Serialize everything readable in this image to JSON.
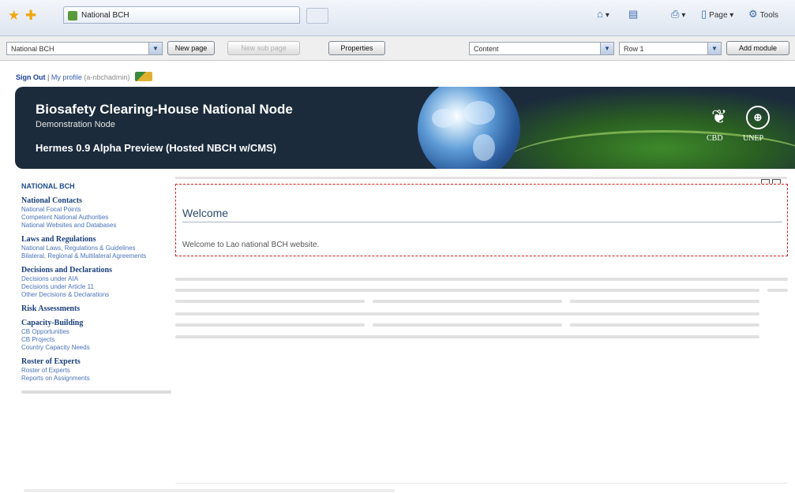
{
  "browser": {
    "tab_title": "National BCH",
    "commands": {
      "home_glyph": "⌂",
      "feeds_glyph": "▤",
      "print_glyph": "⎙",
      "page_label": "Page",
      "page_glyph": "▯",
      "tools_label": "Tools",
      "tools_glyph": "⚙"
    },
    "icons": {
      "favorites": "favorites-star-icon",
      "add_favorite": "add-favorite-icon",
      "star": "★",
      "add": "✚"
    }
  },
  "cms_toolbar": {
    "page_select": "National BCH",
    "new_page": "New page",
    "new_sub_page": "New sub page",
    "properties": "Properties",
    "pane_select": "Content",
    "row_select": "Row 1",
    "add_module": "Add module",
    "arrow": "▼"
  },
  "userbar": {
    "sign_out": "Sign Out",
    "separator": " | ",
    "my_profile": "My profile",
    "username": "(a-nbchadmin)"
  },
  "banner": {
    "title": "Biosafety Clearing-House National Node",
    "subtitle": "Demonstration Node",
    "headline": "Hermes 0.9 Alpha Preview (Hosted NBCH w/CMS)",
    "cbd_label": "CBD",
    "unep_label": "UNEP",
    "cbd_glyph": "❦",
    "unep_glyph": "⊕"
  },
  "nav": {
    "heading": "NATIONAL BCH",
    "sections": [
      {
        "title": "National Contacts",
        "links": [
          "National Focal Points",
          "Competent National Authorities",
          "National Websites and Databases"
        ]
      },
      {
        "title": "Laws and Regulations",
        "links": [
          "National Laws, Regulations & Guidelines",
          "Bilateral, Regional & Multilateral Agreements"
        ]
      },
      {
        "title": "Decisions and Declarations",
        "links": [
          "Decisions under AIA",
          "Decisions under Article 11",
          "Other Decisions & Declarations"
        ]
      },
      {
        "title": "Risk Assessments",
        "links": []
      },
      {
        "title": "Capacity-Building",
        "links": [
          "CB Opportunities",
          "CB Projects",
          "Country Capacity Needs"
        ]
      },
      {
        "title": "Roster of Experts",
        "links": [
          "Roster of Experts",
          "Reports on Assignments"
        ]
      }
    ]
  },
  "module": {
    "title": "Welcome",
    "body": "Welcome to Lao national BCH website."
  }
}
